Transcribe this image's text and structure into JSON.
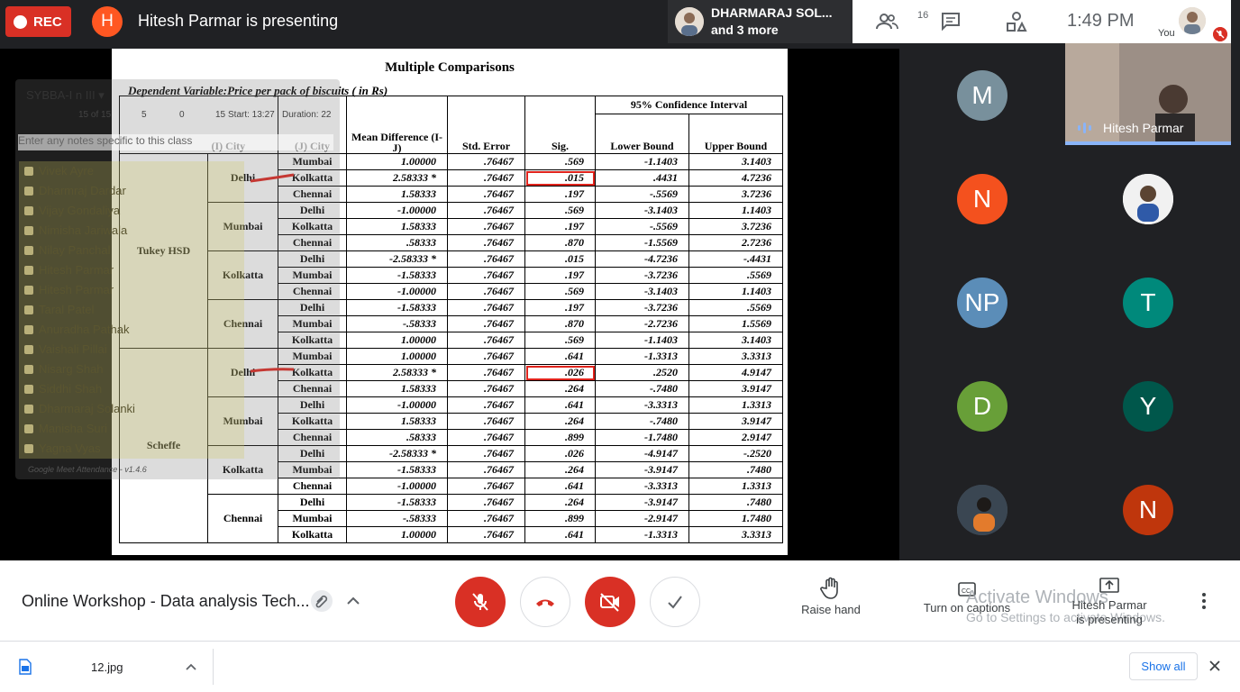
{
  "topbar": {
    "rec_label": "REC",
    "presenter_initial": "H",
    "presenting_text": "Hitesh Parmar is presenting",
    "speaker_line1": "DHARMARAJ SOL...",
    "speaker_line2": "and 3 more",
    "participant_count": "16",
    "time": "1:49 PM",
    "you_label": "You"
  },
  "slide": {
    "title": "Multiple Comparisons",
    "dependent_variable": "Dependent Variable:Price per pack of biscuits ( in Rs)",
    "headers": {
      "i_city": "(I) City",
      "j_city": "(J) City",
      "mean_diff": "Mean Difference (I-J)",
      "std_error": "Std. Error",
      "sig": "Sig.",
      "ci": "95% Confidence Interval",
      "lower": "Lower Bound",
      "upper": "Upper Bound"
    },
    "methods": [
      "Tukey HSD",
      "Scheffe"
    ],
    "rows": [
      [
        "Delhi",
        "Mumbai",
        "1.00000",
        ".76467",
        ".569",
        "-1.1403",
        "3.1403"
      ],
      [
        "Delhi",
        "Kolkatta",
        "2.58333 *",
        ".76467",
        ".015",
        ".4431",
        "4.7236"
      ],
      [
        "Delhi",
        "Chennai",
        "1.58333",
        ".76467",
        ".197",
        "-.5569",
        "3.7236"
      ],
      [
        "Mumbai",
        "Delhi",
        "-1.00000",
        ".76467",
        ".569",
        "-3.1403",
        "1.1403"
      ],
      [
        "Mumbai",
        "Kolkatta",
        "1.58333",
        ".76467",
        ".197",
        "-.5569",
        "3.7236"
      ],
      [
        "Mumbai",
        "Chennai",
        ".58333",
        ".76467",
        ".870",
        "-1.5569",
        "2.7236"
      ],
      [
        "Kolkatta",
        "Delhi",
        "-2.58333 *",
        ".76467",
        ".015",
        "-4.7236",
        "-.4431"
      ],
      [
        "Kolkatta",
        "Mumbai",
        "-1.58333",
        ".76467",
        ".197",
        "-3.7236",
        ".5569"
      ],
      [
        "Kolkatta",
        "Chennai",
        "-1.00000",
        ".76467",
        ".569",
        "-3.1403",
        "1.1403"
      ],
      [
        "Chennai",
        "Delhi",
        "-1.58333",
        ".76467",
        ".197",
        "-3.7236",
        ".5569"
      ],
      [
        "Chennai",
        "Mumbai",
        "-.58333",
        ".76467",
        ".870",
        "-2.7236",
        "1.5569"
      ],
      [
        "Chennai",
        "Kolkatta",
        "1.00000",
        ".76467",
        ".569",
        "-1.1403",
        "3.1403"
      ],
      [
        "Delhi",
        "Mumbai",
        "1.00000",
        ".76467",
        ".641",
        "-1.3313",
        "3.3313"
      ],
      [
        "Delhi",
        "Kolkatta",
        "2.58333 *",
        ".76467",
        ".026",
        ".2520",
        "4.9147"
      ],
      [
        "Delhi",
        "Chennai",
        "1.58333",
        ".76467",
        ".264",
        "-.7480",
        "3.9147"
      ],
      [
        "Mumbai",
        "Delhi",
        "-1.00000",
        ".76467",
        ".641",
        "-3.3313",
        "1.3313"
      ],
      [
        "Mumbai",
        "Kolkatta",
        "1.58333",
        ".76467",
        ".264",
        "-.7480",
        "3.9147"
      ],
      [
        "Mumbai",
        "Chennai",
        ".58333",
        ".76467",
        ".899",
        "-1.7480",
        "2.9147"
      ],
      [
        "Kolkatta",
        "Delhi",
        "-2.58333 *",
        ".76467",
        ".026",
        "-4.9147",
        "-.2520"
      ],
      [
        "Kolkatta",
        "Mumbai",
        "-1.58333",
        ".76467",
        ".264",
        "-3.9147",
        ".7480"
      ],
      [
        "Kolkatta",
        "Chennai",
        "-1.00000",
        ".76467",
        ".641",
        "-3.3313",
        "1.3313"
      ],
      [
        "Chennai",
        "Delhi",
        "-1.58333",
        ".76467",
        ".264",
        "-3.9147",
        ".7480"
      ],
      [
        "Chennai",
        "Mumbai",
        "-.58333",
        ".76467",
        ".899",
        "-2.9147",
        "1.7480"
      ],
      [
        "Chennai",
        "Kolkatta",
        "1.00000",
        ".76467",
        ".641",
        "-1.3313",
        "3.3313"
      ]
    ]
  },
  "overlay": {
    "class_select": "SYBBA-I n III",
    "present_count": "15 of 15",
    "stat_a": "5",
    "stat_b": "0",
    "stat_c": "15",
    "start": "Start: 13:27",
    "duration": "Duration: 22",
    "notes_placeholder": "Enter any notes specific to this class",
    "students": [
      "Vivek Ayre",
      "Dharmraj Dardar",
      "Vijay Gondaliya",
      "Nimisha Jariwala",
      "Nilay Panchal",
      "Hitesh Parmar",
      "Hitesh Parmar",
      "Taral Patel",
      "Anuradha Pathak",
      "Vaishali Pillai",
      "Nisarg Shah",
      "Siddhi Shah",
      "Dharmaraj Solanki",
      "Manisha Suri",
      "Yagna Vyas"
    ],
    "footer": "Google Meet Attendance - v1.4.6"
  },
  "rail": {
    "tiles": [
      {
        "initial": "M",
        "color": "#78909c"
      },
      {
        "initial": "N",
        "color": "#f4511e"
      },
      {
        "initial": "",
        "color": "#ffffff"
      },
      {
        "initial": "NP",
        "color": "#5b8db8"
      },
      {
        "initial": "T",
        "color": "#00897b"
      },
      {
        "initial": "D",
        "color": "#689f38"
      },
      {
        "initial": "Y",
        "color": "#00574b"
      },
      {
        "initial": "",
        "color": "#4a5058"
      },
      {
        "initial": "N",
        "color": "#bf360c"
      }
    ],
    "presenter_tile_name": "Hitesh Parmar"
  },
  "bottombar": {
    "meeting_title": "Online Workshop - Data analysis Tech...",
    "raise_hand": "Raise hand",
    "captions": "Turn on captions",
    "presenting_line1": "Hitesh Parmar",
    "presenting_line2": "is presenting",
    "watermark1": "Activate Windows",
    "watermark2": "Go to Settings to activate Windows."
  },
  "downloads": {
    "file": "12.jpg",
    "show_all": "Show all"
  }
}
